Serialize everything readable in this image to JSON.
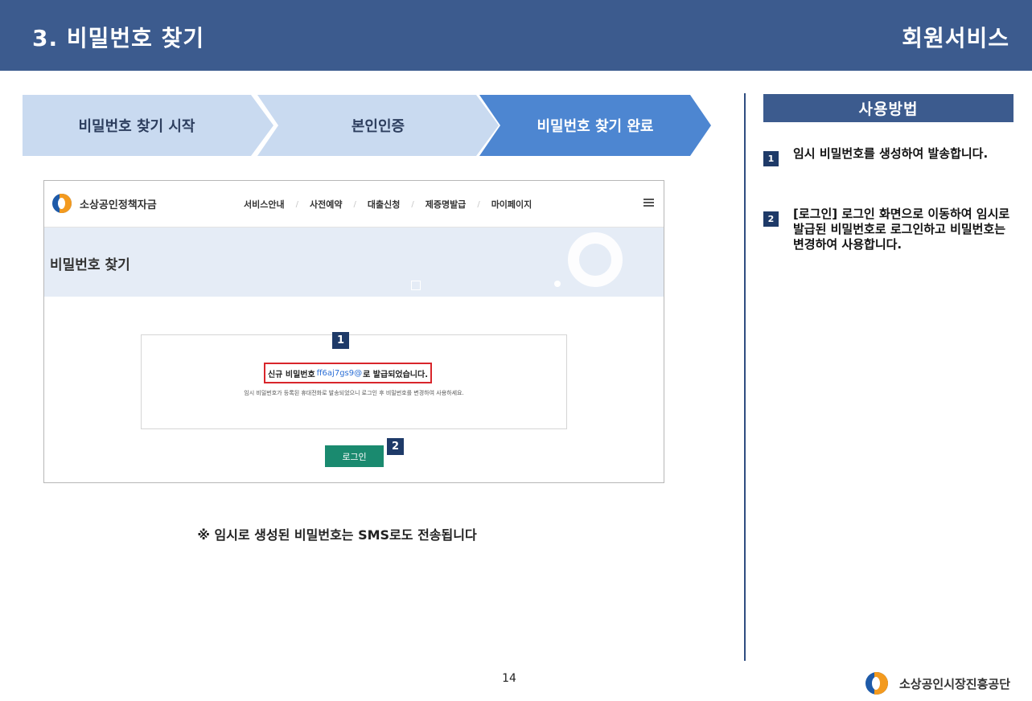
{
  "header": {
    "title": "3. 비밀번호 찾기",
    "section": "회원서비스"
  },
  "steps": [
    {
      "label": "비밀번호 찾기 시작"
    },
    {
      "label": "본인인증"
    },
    {
      "label": "비밀번호 찾기 완료"
    }
  ],
  "screenshot": {
    "logo_text": "소상공인정책자금",
    "nav": [
      "서비스안내",
      "사전예약",
      "대출신청",
      "제증명발급",
      "마이페이지"
    ],
    "nav_separator": "/",
    "banner_title": "비밀번호 찾기",
    "result": {
      "prefix": "신규 비밀번호",
      "password": "ff6aj7gs9@",
      "suffix": "로 발급되었습니다.",
      "note": "임시 비밀번호가 등록된 휴대전화로 발송되었으니 로그인 후 비밀번호를 변경하여 사용하세요."
    },
    "login_button": "로그인"
  },
  "badges": [
    "1",
    "2"
  ],
  "footnote": "※ 임시로 생성된 비밀번호는 SMS로도 전송됩니다",
  "page_number": "14",
  "howto": {
    "title": "사용방법",
    "items": [
      {
        "num": "1",
        "text": "임시 비밀번호를 생성하여 발송합니다."
      },
      {
        "num": "2",
        "text": "[로그인] 로그인 화면으로 이동하여 임시로 발급된 비밀번호로 로그인하고 비밀번호는 변경하여 사용합니다."
      }
    ]
  },
  "footer": {
    "org_name": "소상공인시장진흥공단"
  },
  "colors": {
    "header_bg": "#3c5b8e",
    "step_inactive": "#c9daf0",
    "step_active": "#4d86d1",
    "badge_bg": "#1e3a68",
    "highlight_border": "#d8252b",
    "login_button_bg": "#1a8a6f",
    "password_text": "#2a6ed6"
  }
}
